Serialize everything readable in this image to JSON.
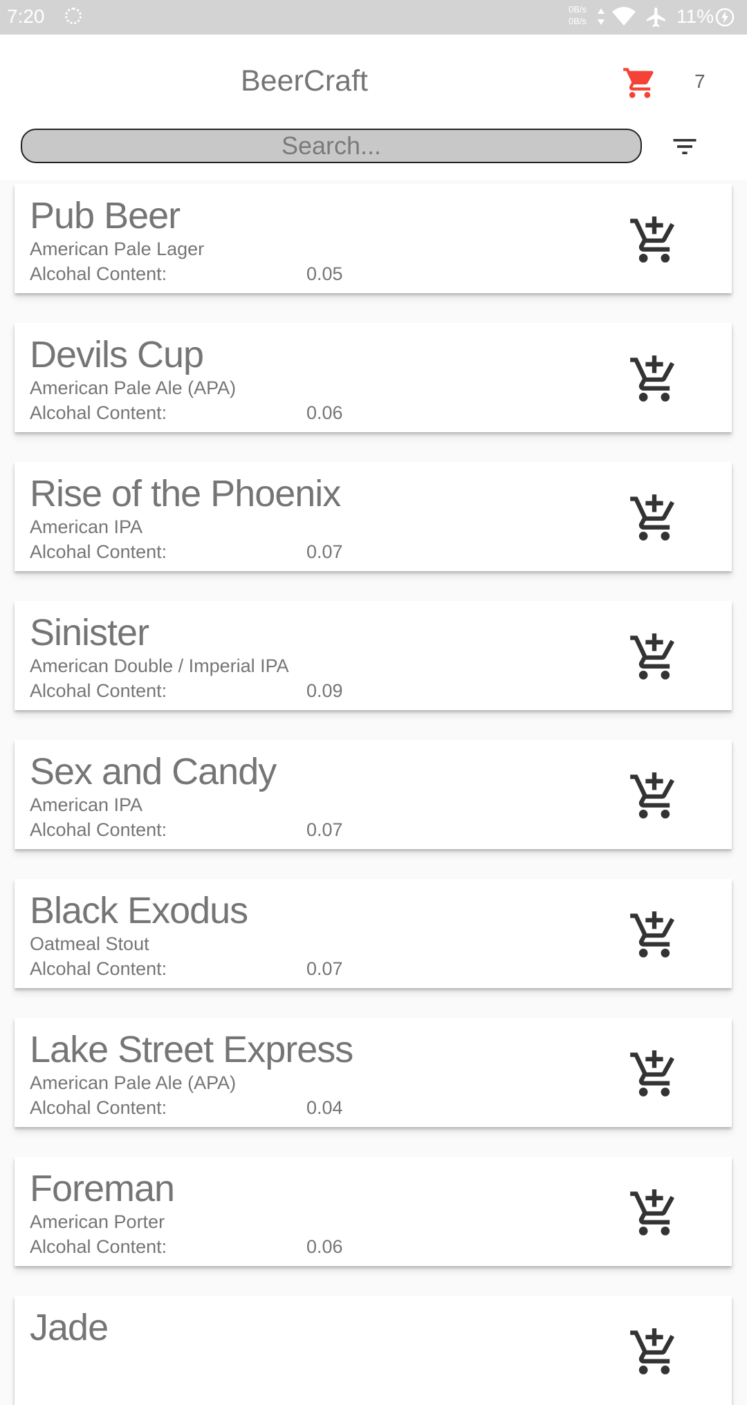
{
  "status_bar": {
    "time": "7:20",
    "net_speed_up": "0B/s",
    "net_speed_down": "0B/s",
    "battery": "11%"
  },
  "header": {
    "title": "BeerCraft",
    "cart_count": "7",
    "cart_color": "#f44336"
  },
  "search": {
    "placeholder": "Search..."
  },
  "beers": [
    {
      "name": "Pub Beer",
      "style": "American Pale Lager",
      "abv_label": "Alcohal Content:",
      "abv": "0.05"
    },
    {
      "name": "Devils Cup",
      "style": "American Pale Ale (APA)",
      "abv_label": "Alcohal Content:",
      "abv": "0.06"
    },
    {
      "name": "Rise of the Phoenix",
      "style": "American IPA",
      "abv_label": "Alcohal Content:",
      "abv": "0.07"
    },
    {
      "name": "Sinister",
      "style": "American Double / Imperial IPA",
      "abv_label": "Alcohal Content:",
      "abv": "0.09"
    },
    {
      "name": "Sex and Candy",
      "style": "American IPA",
      "abv_label": "Alcohal Content:",
      "abv": "0.07"
    },
    {
      "name": "Black Exodus",
      "style": "Oatmeal Stout",
      "abv_label": "Alcohal Content:",
      "abv": "0.07"
    },
    {
      "name": "Lake Street Express",
      "style": "American Pale Ale (APA)",
      "abv_label": "Alcohal Content:",
      "abv": "0.04"
    },
    {
      "name": "Foreman",
      "style": "American Porter",
      "abv_label": "Alcohal Content:",
      "abv": "0.06"
    },
    {
      "name": "Jade",
      "style": "",
      "abv_label": "",
      "abv": ""
    }
  ]
}
